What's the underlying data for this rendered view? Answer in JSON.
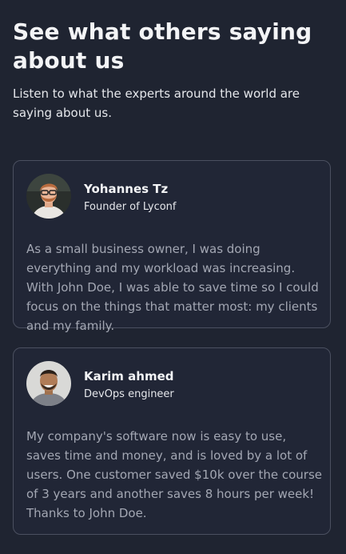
{
  "section": {
    "heading": "See what others saying about us",
    "subheading": "Listen to what the experts around the world are saying about us."
  },
  "testimonials": [
    {
      "name": "Yohannes Tz",
      "role": "Founder of Lyconf",
      "quote": "As a small business owner, I was doing everything and my workload was increasing. With John Doe, I was able to save time so I could focus on the things that matter most: my clients and my family."
    },
    {
      "name": "Karim ahmed",
      "role": "DevOps engineer",
      "quote": "My company's software now is easy to use, saves time and money, and is loved by a lot of users. One customer saved $10k over the course of 3 years and another saves 8 hours per week! Thanks to John Doe."
    }
  ],
  "colors": {
    "background": "#1f2431",
    "card_border": "#4b5060",
    "heading": "#f3f4f6",
    "quote_text": "#a3a7b3"
  },
  "icons": {
    "avatar_1": "avatar-photo-bearded-man-glasses",
    "avatar_2": "avatar-photo-smiling-man"
  }
}
